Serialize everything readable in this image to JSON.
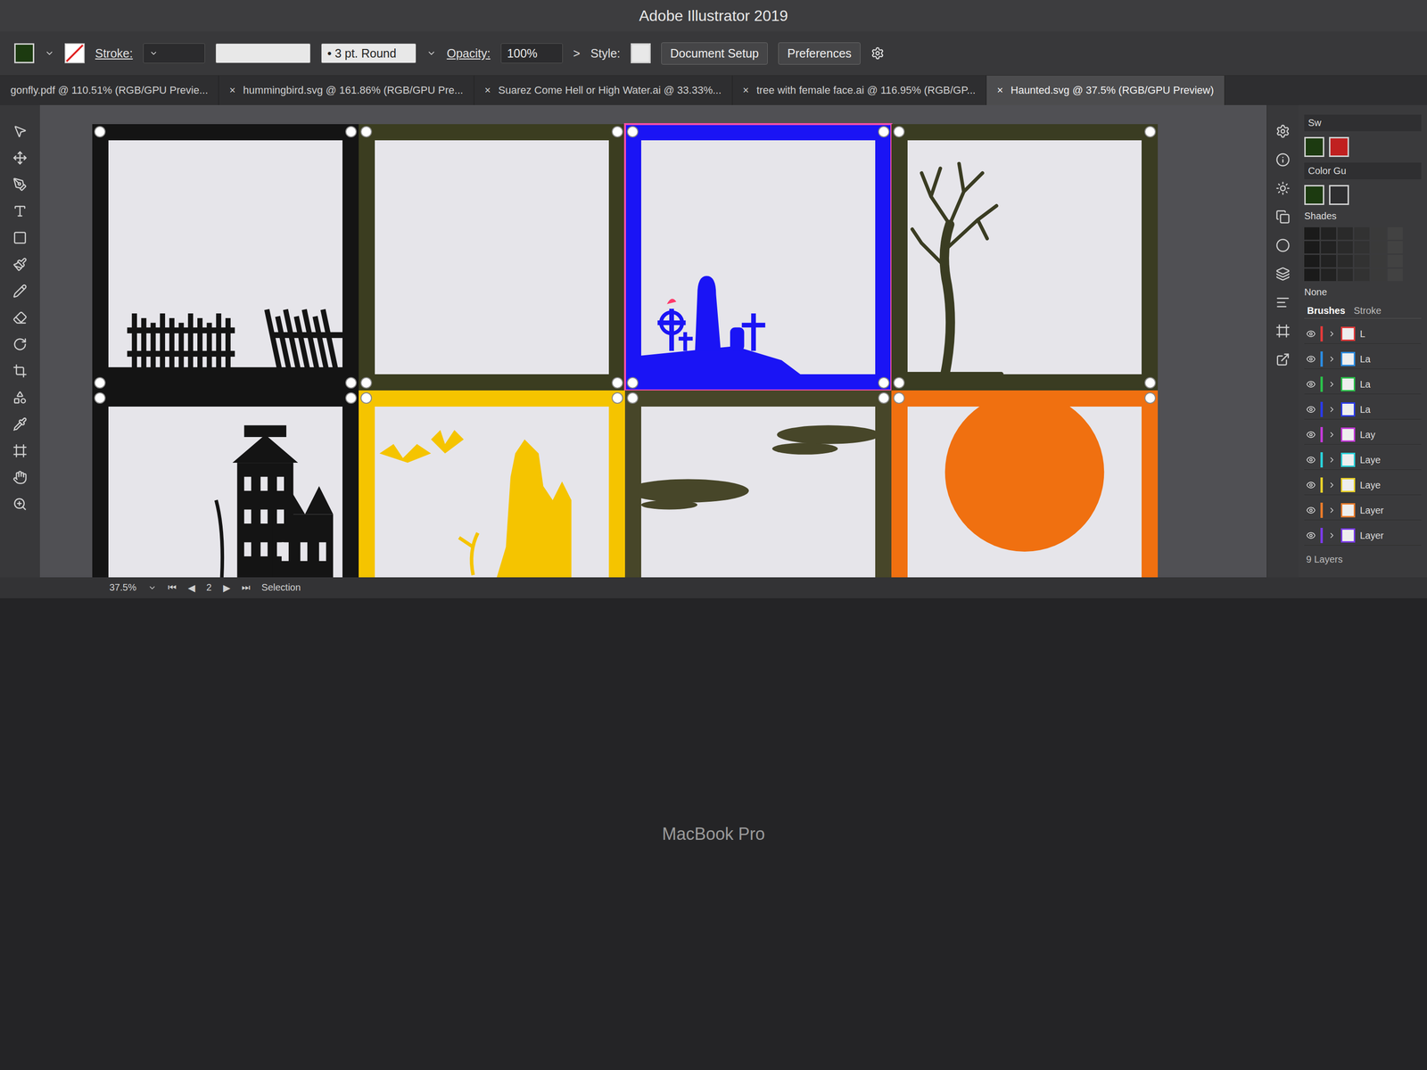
{
  "window": {
    "title": "Adobe Illustrator 2019"
  },
  "control_bar": {
    "stroke_label": "Stroke:",
    "brush": "3 pt. Round",
    "opacity_label": "Opacity:",
    "opacity": "100%",
    "opacity_arrow": ">",
    "style_label": "Style:",
    "buttons": [
      "Document Setup",
      "Preferences"
    ]
  },
  "tabs": [
    {
      "label": "gonfly.pdf @ 110.51% (RGB/GPU Previe...",
      "close": "",
      "selected": false
    },
    {
      "label": "hummingbird.svg @ 161.86% (RGB/GPU Pre...",
      "close": "×",
      "selected": false
    },
    {
      "label": "Suarez Come Hell or High Water.ai @ 33.33%...",
      "close": "×",
      "selected": false
    },
    {
      "label": "tree with female face.ai @ 116.95% (RGB/GP...",
      "close": "×",
      "selected": false
    },
    {
      "label": "Haunted.svg @ 37.5% (RGB/GPU Preview)",
      "close": "×",
      "selected": true
    }
  ],
  "artboards": [
    {
      "kind": "fence",
      "color": "#141414",
      "selected": false
    },
    {
      "kind": "empty",
      "color": "#3b3d20",
      "selected": false
    },
    {
      "kind": "graveyard",
      "color": "#1a14f5",
      "selected": true
    },
    {
      "kind": "tree",
      "color": "#3a3c22",
      "selected": false
    },
    {
      "kind": "house",
      "color": "#141414",
      "selected": false
    },
    {
      "kind": "castle",
      "color": "#f5c400",
      "selected": false
    },
    {
      "kind": "clouds",
      "color": "#474629",
      "selected": false
    },
    {
      "kind": "moon",
      "color": "#f07010",
      "selected": false
    },
    {
      "kind": "solid",
      "color": "#4a0fb4",
      "selected": false
    }
  ],
  "right_panel": {
    "swatches_label": "Sw",
    "color_guide_label": "Color Gu",
    "shades_label": "Shades",
    "none_label": "None",
    "tabs": [
      {
        "label": "Brushes",
        "selected": true
      },
      {
        "label": "Stroke",
        "selected": false
      }
    ],
    "layers": [
      {
        "name": "L",
        "color": "#e23a3a",
        "visible": true
      },
      {
        "name": "La",
        "color": "#2b8be0",
        "visible": true
      },
      {
        "name": "La",
        "color": "#2bc04a",
        "visible": true
      },
      {
        "name": "La",
        "color": "#2a3ae8",
        "visible": true
      },
      {
        "name": "Lay",
        "color": "#c43ad8",
        "visible": true
      },
      {
        "name": "Laye",
        "color": "#2ad0d8",
        "visible": true
      },
      {
        "name": "Laye",
        "color": "#e8d02a",
        "visible": true
      },
      {
        "name": "Layer",
        "color": "#e87a2a",
        "visible": true
      },
      {
        "name": "Layer",
        "color": "#7a3ae8",
        "visible": true
      }
    ],
    "layers_count": "9 Layers"
  },
  "status_bar": {
    "zoom": "37.5%",
    "nav_prev": [
      "⏮",
      "◀"
    ],
    "artboard": "2",
    "nav_next": [
      "▶",
      "⏭"
    ],
    "tool": "Selection"
  },
  "device": {
    "label": "MacBook Pro"
  }
}
